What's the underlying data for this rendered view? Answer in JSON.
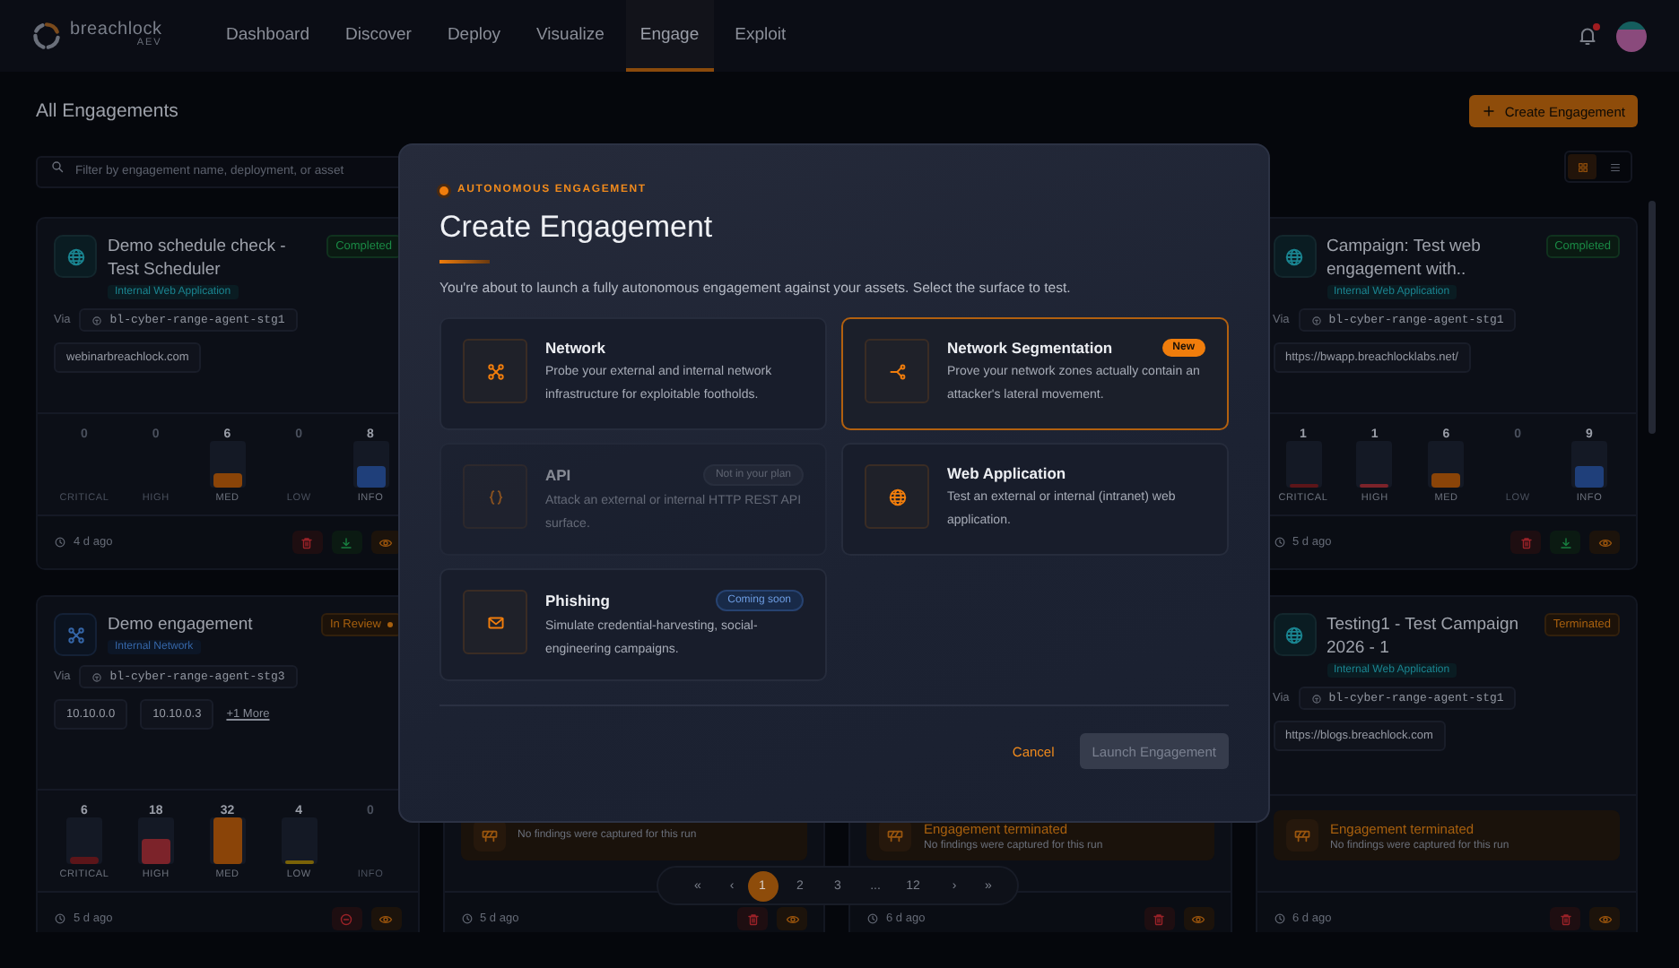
{
  "header": {
    "brand": "breachlock",
    "brand_sub": "AEV",
    "nav": [
      {
        "label": "Dashboard",
        "selected": false
      },
      {
        "label": "Discover",
        "selected": false
      },
      {
        "label": "Deploy",
        "selected": false
      },
      {
        "label": "Visualize",
        "selected": false
      },
      {
        "label": "Engage",
        "selected": true
      },
      {
        "label": "Exploit",
        "selected": false
      }
    ],
    "notifications_unread": true
  },
  "page": {
    "title": "All Engagements",
    "create_button": "Create Engagement",
    "search": {
      "placeholder": "Filter by engagement name, deployment, or asset"
    },
    "view_toggle": [
      {
        "kind": "grid",
        "selected": true
      },
      {
        "kind": "list",
        "selected": false
      }
    ]
  },
  "card_columns": [
    [
      {
        "title": "Demo schedule check - Test Scheduler",
        "target": {
          "label": "Internal Web Application",
          "kind": "web"
        },
        "status": {
          "label": "Completed",
          "kind": "completed"
        },
        "via_label": "Via",
        "agent": "bl-cyber-range-agent-stg1",
        "assets": [
          "webinarbreachlock.com"
        ],
        "findings": [
          {
            "count": "0",
            "label": "CRITICAL"
          },
          {
            "count": "0",
            "label": "HIGH"
          },
          {
            "count": "6",
            "label": "MED",
            "level": 0.3,
            "color": "#8a4408"
          },
          {
            "count": "0",
            "label": "LOW"
          },
          {
            "count": "8",
            "label": "INFO",
            "level": 0.45,
            "color": "#1f3f7a"
          }
        ],
        "age": "4 d ago",
        "actions": [
          {
            "kind": "delete"
          },
          {
            "kind": "download"
          },
          {
            "kind": "view"
          }
        ]
      },
      {
        "title": "Demo engagement",
        "target": {
          "label": "Internal Network",
          "kind": "network"
        },
        "status": {
          "label": "In Review",
          "kind": "review"
        },
        "via_label": "Via",
        "agent": "bl-cyber-range-agent-stg3",
        "assets": [
          "10.10.0.0",
          "10.10.0.3"
        ],
        "more": "+1 More",
        "findings": [
          {
            "count": "6",
            "label": "CRITICAL",
            "level": 0.15,
            "color": "#5c1519"
          },
          {
            "count": "18",
            "label": "HIGH",
            "level": 0.55,
            "color": "#7c232a"
          },
          {
            "count": "32",
            "label": "MED",
            "level": 1,
            "color": "#8a4408"
          },
          {
            "count": "4",
            "label": "LOW",
            "level": 0.08,
            "color": "#7a6208"
          },
          {
            "count": "0",
            "label": "INFO"
          }
        ],
        "age": "5 d ago",
        "actions": [
          {
            "kind": "cancel"
          },
          {
            "kind": "view"
          }
        ]
      }
    ],
    [
      {
        "terminated": {
          "note": "No findings were captured for this run"
        },
        "age": "5 d ago",
        "actions": [
          {
            "kind": "delete"
          },
          {
            "kind": "view"
          }
        ]
      }
    ],
    [
      {
        "terminated": {
          "title": "Engagement terminated",
          "note": "No findings were captured for this run"
        },
        "age": "6 d ago",
        "actions": [
          {
            "kind": "delete"
          },
          {
            "kind": "view"
          }
        ]
      }
    ],
    [
      {
        "title": "Campaign: Test web engagement with..",
        "target": {
          "label": "Internal Web Application",
          "kind": "web"
        },
        "status": {
          "label": "Completed",
          "kind": "completed"
        },
        "via_label": "Via",
        "agent": "bl-cyber-range-agent-stg1",
        "assets": [
          "https://bwapp.breachlocklabs.net/"
        ],
        "findings": [
          {
            "count": "1",
            "label": "CRITICAL",
            "level": 0.08,
            "color": "#5c1519"
          },
          {
            "count": "1",
            "label": "HIGH",
            "level": 0.08,
            "color": "#7c232a"
          },
          {
            "count": "6",
            "label": "MED",
            "level": 0.3,
            "color": "#8a4408"
          },
          {
            "count": "0",
            "label": "LOW"
          },
          {
            "count": "9",
            "label": "INFO",
            "level": 0.45,
            "color": "#1f3f7a"
          }
        ],
        "age": "5 d ago",
        "actions": [
          {
            "kind": "delete"
          },
          {
            "kind": "download"
          },
          {
            "kind": "view"
          }
        ]
      },
      {
        "title": "Testing1 - Test Campaign 2026 - 1",
        "target": {
          "label": "Internal Web Application",
          "kind": "web"
        },
        "status": {
          "label": "Terminated",
          "kind": "terminated"
        },
        "via_label": "Via",
        "agent": "bl-cyber-range-agent-stg1",
        "assets": [
          "https://blogs.breachlock.com"
        ],
        "terminated": {
          "title": "Engagement terminated",
          "note": "No findings were captured for this run"
        },
        "age": "6 d ago",
        "actions": [
          {
            "kind": "delete"
          },
          {
            "kind": "view"
          }
        ]
      }
    ]
  ],
  "pagination": [
    {
      "label": "«",
      "kind": "nav",
      "selected": false
    },
    {
      "label": "‹",
      "kind": "nav",
      "selected": false
    },
    {
      "label": "1",
      "kind": "page",
      "selected": true
    },
    {
      "label": "2",
      "kind": "page",
      "selected": false
    },
    {
      "label": "3",
      "kind": "page",
      "selected": false
    },
    {
      "label": "...",
      "kind": "ellipsis",
      "selected": false
    },
    {
      "label": "12",
      "kind": "page",
      "selected": false
    },
    {
      "label": "›",
      "kind": "nav",
      "selected": false
    },
    {
      "label": "»",
      "kind": "nav",
      "selected": false
    }
  ],
  "modal": {
    "eyebrow": "AUTONOMOUS ENGAGEMENT",
    "title": "Create Engagement",
    "description": "You're about to launch a fully autonomous engagement against your assets. Select the surface to test.",
    "options": [
      {
        "kind": "network",
        "title": "Network",
        "description": "Probe your external and internal network infrastructure for exploitable footholds.",
        "selected": false,
        "disabled": false
      },
      {
        "kind": "segmentation",
        "title": "Network Segmentation",
        "description": "Prove your network zones actually contain an attacker's lateral movement.",
        "badge": {
          "label": "New",
          "kind": "new"
        },
        "selected": true,
        "disabled": false
      },
      {
        "kind": "api",
        "title": "API",
        "description": "Attack an external or internal HTTP REST API surface.",
        "badge": {
          "label": "Not in your plan",
          "kind": "plan"
        },
        "selected": false,
        "disabled": true
      },
      {
        "kind": "web",
        "title": "Web Application",
        "description": "Test an external or internal (intranet) web application.",
        "selected": false,
        "disabled": false
      },
      {
        "kind": "mail",
        "title": "Phishing",
        "description": "Simulate credential-harvesting, social-engineering campaigns.",
        "badge": {
          "label": "Coming soon",
          "kind": "soon"
        },
        "selected": false,
        "disabled": false
      }
    ],
    "cancel": "Cancel",
    "launch": {
      "label": "Launch Engagement",
      "disabled": true
    }
  }
}
